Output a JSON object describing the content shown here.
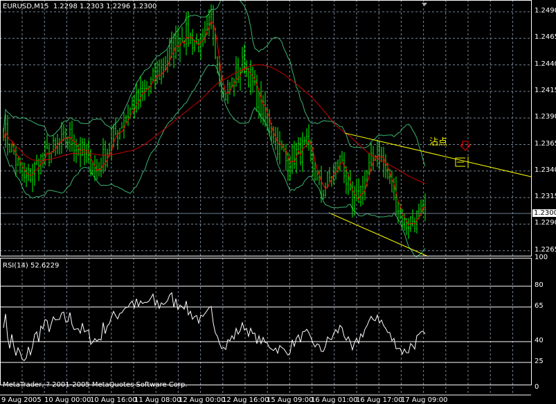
{
  "header": {
    "symbol": "EURUSD,M15",
    "open": "1.2298",
    "high": "1.2303",
    "low": "1.2296",
    "close": "1.2300"
  },
  "price_axis": [
    "1.2490",
    "1.2465",
    "1.2440",
    "1.2415",
    "1.2390",
    "1.2365",
    "1.2340",
    "1.2315",
    "1.2290",
    "1.2265"
  ],
  "current_price": "1.2300",
  "rsi": {
    "label": "RSI(14) 52.6229",
    "levels": [
      "100",
      "80",
      "65",
      "40",
      "25",
      "0"
    ]
  },
  "time_axis": [
    "9 Aug 2005",
    "10 Aug 00:00",
    "10 Aug 16:00",
    "11 Aug 08:00",
    "12 Aug 00:00",
    "12 Aug 16:00",
    "15 Aug 09:00",
    "16 Aug 01:00",
    "16 Aug 17:00",
    "17 Aug 09:00"
  ],
  "copyright": "MetaTrader, ? 2001-2005 MetaQuotes Software Corp.",
  "annotation": {
    "text": "沾点"
  },
  "colors": {
    "bars": "#00ff00",
    "ma": "#ff0000",
    "bands": "#3cb371",
    "trendline": "#ffff00",
    "grid": "#778899",
    "arrow": "#ff0000"
  },
  "chart_data": {
    "type": "line",
    "note": "approximate close path, bar index vs price",
    "path": [
      [
        0,
        1.238
      ],
      [
        10,
        1.233
      ],
      [
        18,
        1.235
      ],
      [
        32,
        1.2372
      ],
      [
        45,
        1.234
      ],
      [
        58,
        1.239
      ],
      [
        75,
        1.2432
      ],
      [
        86,
        1.247
      ],
      [
        96,
        1.2458
      ],
      [
        100,
        1.2482
      ],
      [
        106,
        1.241
      ],
      [
        116,
        1.2442
      ],
      [
        126,
        1.239
      ],
      [
        136,
        1.235
      ],
      [
        146,
        1.2362
      ],
      [
        153,
        1.232
      ],
      [
        163,
        1.2352
      ],
      [
        168,
        1.2302
      ],
      [
        180,
        1.2362
      ],
      [
        193,
        1.229
      ],
      [
        203,
        1.23
      ]
    ]
  }
}
